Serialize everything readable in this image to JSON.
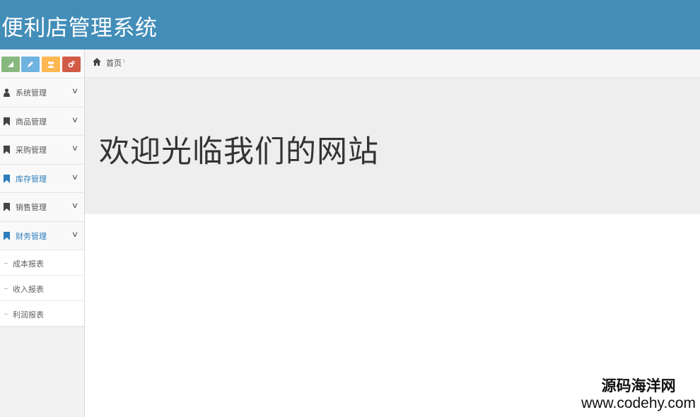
{
  "app": {
    "title": "便利店管理系统"
  },
  "shortcuts": [
    {
      "icon": "signal-icon",
      "color": "#87b87f"
    },
    {
      "icon": "pencil-icon",
      "color": "#6fb3e0"
    },
    {
      "icon": "users-icon",
      "color": "#ffb752"
    },
    {
      "icon": "cogs-icon",
      "color": "#d15b47"
    }
  ],
  "sidebar": {
    "items": [
      {
        "label": "系统管理",
        "icon": "user-icon"
      },
      {
        "label": "商品管理",
        "icon": "bookmark-icon"
      },
      {
        "label": "采购管理",
        "icon": "bookmark-icon"
      },
      {
        "label": "库存管理",
        "icon": "bookmark-icon",
        "highlight": true
      },
      {
        "label": "销售管理",
        "icon": "bookmark-icon"
      },
      {
        "label": "财务管理",
        "icon": "bookmark-icon",
        "highlight": true,
        "expanded": true
      }
    ],
    "submenu": [
      {
        "label": "成本报表"
      },
      {
        "label": "收入报表"
      },
      {
        "label": "利润报表"
      }
    ]
  },
  "breadcrumb": {
    "home": "首页",
    "separator": "›"
  },
  "main": {
    "welcome": "欢迎光临我们的网站"
  },
  "watermark": {
    "name": "源码海洋网",
    "url": "www.codehy.com"
  },
  "colors": {
    "header": "#438eb9",
    "highlight": "#2b7dbc"
  }
}
